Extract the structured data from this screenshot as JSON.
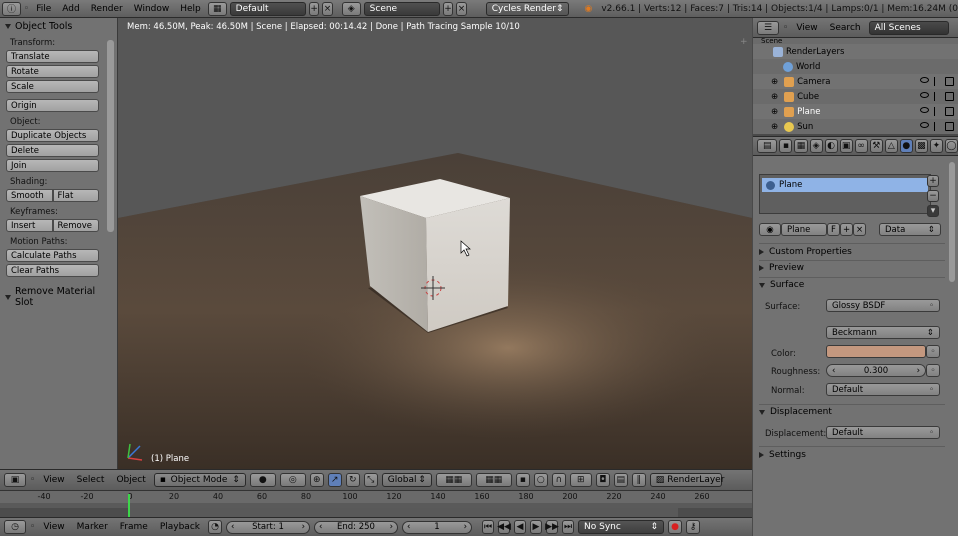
{
  "top_bar": {
    "menus": [
      "File",
      "Add",
      "Render",
      "Window",
      "Help"
    ],
    "layout": "Default",
    "scene": "Scene",
    "engine": "Cycles Render",
    "stats": "v2.66.1 | Verts:12 | Faces:7 | Tris:14 | Objects:1/4 | Lamps:0/1 | Mem:16.24M (0"
  },
  "tool_shelf": {
    "title": "Object Tools",
    "transform_label": "Transform:",
    "translate": "Translate",
    "rotate": "Rotate",
    "scale": "Scale",
    "origin": "Origin",
    "object_label": "Object:",
    "duplicate": "Duplicate Objects",
    "delete": "Delete",
    "join": "Join",
    "shading_label": "Shading:",
    "smooth": "Smooth",
    "flat": "Flat",
    "keyframes_label": "Keyframes:",
    "insert": "Insert",
    "remove": "Remove",
    "motion_label": "Motion Paths:",
    "calc_paths": "Calculate Paths",
    "clear_paths": "Clear Paths",
    "remove_slot": "Remove Material Slot"
  },
  "viewport": {
    "render_info": "Mem: 46.50M, Peak: 46.50M | Scene | Elapsed: 00:14.42 | Done | Path Tracing Sample 10/10",
    "active_object": "(1) Plane"
  },
  "viewport_header": {
    "view": "View",
    "select": "Select",
    "object": "Object",
    "mode": "Object Mode",
    "orientation": "Global",
    "render_layer": "RenderLayer"
  },
  "timeline": {
    "ticks": [
      "-40",
      "-20",
      "0",
      "20",
      "40",
      "60",
      "80",
      "100",
      "120",
      "140",
      "160",
      "180",
      "200",
      "220",
      "240",
      "260"
    ],
    "view": "View",
    "marker": "Marker",
    "frame": "Frame",
    "playback": "Playback",
    "start": "Start: 1",
    "end": "End: 250",
    "current": "1",
    "sync": "No Sync"
  },
  "outliner": {
    "view": "View",
    "search": "Search",
    "filter": "All Scenes",
    "items": [
      {
        "name": "Scene",
        "color": "#d8d8d8"
      },
      {
        "name": "RenderLayers",
        "color": "#9ab3d8"
      },
      {
        "name": "World",
        "color": "#6fa0d8"
      },
      {
        "name": "Camera",
        "color": "#e0a050"
      },
      {
        "name": "Cube",
        "color": "#e0a050"
      },
      {
        "name": "Plane",
        "color": "#e0a050"
      },
      {
        "name": "Sun",
        "color": "#e8c850"
      }
    ]
  },
  "properties": {
    "slot_name": "Plane",
    "material_name": "Plane",
    "fake_user": "F",
    "link": "Data",
    "custom_props": "Custom Properties",
    "preview": "Preview",
    "surface_section": "Surface",
    "surface_label": "Surface:",
    "surface_value": "Glossy BSDF",
    "distribution": "Beckmann",
    "color_label": "Color:",
    "color_value": "#c4987f",
    "roughness_label": "Roughness:",
    "roughness_value": "0.300",
    "normal_label": "Normal:",
    "normal_value": "Default",
    "displacement_section": "Displacement",
    "displacement_label": "Displacement:",
    "displacement_value": "Default",
    "settings": "Settings"
  }
}
